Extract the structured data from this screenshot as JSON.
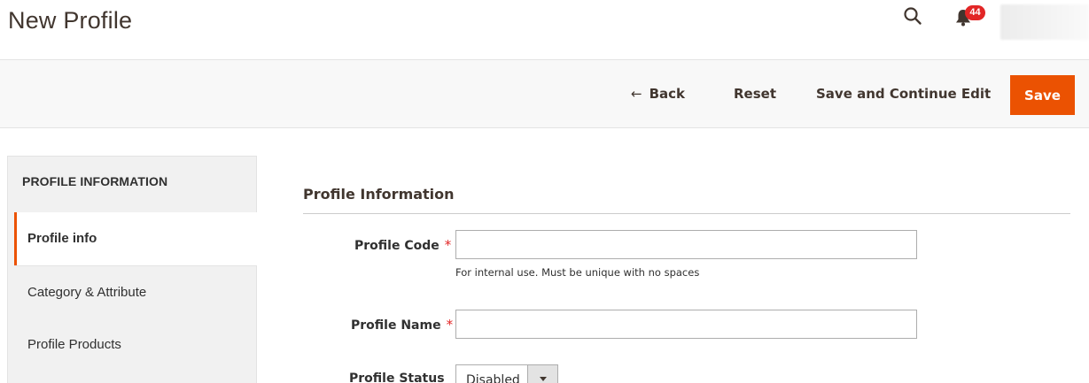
{
  "header": {
    "title": "New Profile",
    "notification_count": "44"
  },
  "actions": {
    "back_arrow": "←",
    "back_label": "Back",
    "reset_label": "Reset",
    "save_continue_label": "Save and Continue Edit",
    "save_label": "Save"
  },
  "sidebar": {
    "title": "PROFILE INFORMATION",
    "items": [
      {
        "label": "Profile info",
        "active": true
      },
      {
        "label": "Category & Attribute",
        "active": false
      },
      {
        "label": "Profile Products",
        "active": false
      }
    ]
  },
  "form": {
    "section_title": "Profile Information",
    "required_mark": "*",
    "profile_code": {
      "label": "Profile Code",
      "value": "",
      "note": "For internal use. Must be unique with no spaces"
    },
    "profile_name": {
      "label": "Profile Name",
      "value": ""
    },
    "profile_status": {
      "label": "Profile Status",
      "selected": "Disabled"
    }
  },
  "colors": {
    "accent": "#eb5202",
    "badge": "#e22626"
  },
  "icons": {
    "search": "search-icon",
    "notifications": "bell-icon",
    "back": "arrow-left-icon",
    "dropdown": "chevron-down-icon"
  }
}
